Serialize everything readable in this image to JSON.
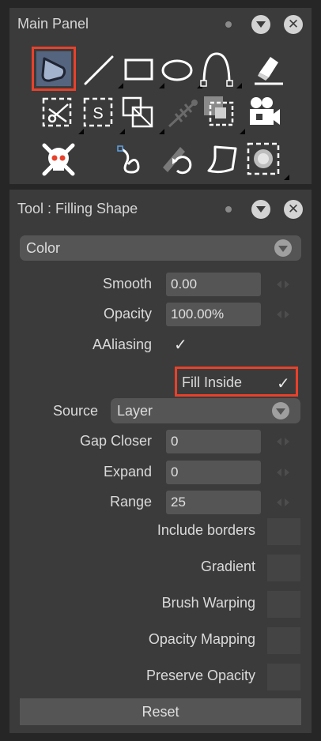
{
  "main_panel": {
    "title": "Main Panel",
    "tools": [
      {
        "icon": "geometric-fill-tool-icon",
        "selected": true
      },
      {
        "icon": "brush-line-tool-icon"
      },
      {
        "icon": "rectangle-tool-icon"
      },
      {
        "icon": "ellipse-tool-icon"
      },
      {
        "icon": "curve-tool-icon"
      },
      {
        "icon": "eraser-tool-icon"
      },
      {
        "icon": "cutter-tool-icon"
      },
      {
        "icon": "selection-tool-icon"
      },
      {
        "icon": "transform-tool-icon"
      },
      {
        "icon": "skeleton-tool-icon"
      },
      {
        "icon": "camera-frame-tool-icon"
      },
      {
        "icon": "camera-tool-icon"
      },
      {
        "icon": "skull-crossbones-tool-icon"
      },
      {
        "icon": "curl-path-tool-icon"
      },
      {
        "icon": "rotate-pencil-tool-icon"
      },
      {
        "icon": "paper-tool-icon"
      },
      {
        "icon": "blur-circle-tool-icon"
      }
    ]
  },
  "tool_panel": {
    "title": "Tool : Filling Shape",
    "mode_dropdown": "Color",
    "smooth": {
      "label": "Smooth",
      "value": "0.00"
    },
    "opacity": {
      "label": "Opacity",
      "value": "100.00%"
    },
    "aaliasing": {
      "label": "AAliasing",
      "checked": true,
      "mark": "✓"
    },
    "fill_inside": {
      "label": "Fill Inside",
      "checked": true,
      "mark": "✓"
    },
    "source": {
      "label": "Source",
      "value": "Layer"
    },
    "gap_closer": {
      "label": "Gap Closer",
      "value": "0"
    },
    "expand": {
      "label": "Expand",
      "value": "0"
    },
    "range": {
      "label": "Range",
      "value": "25"
    },
    "include_borders": {
      "label": "Include borders",
      "checked": false
    },
    "gradient": {
      "label": "Gradient",
      "checked": false
    },
    "brush_warping": {
      "label": "Brush Warping",
      "checked": false
    },
    "opacity_mapping": {
      "label": "Opacity Mapping",
      "checked": false
    },
    "preserve_opacity": {
      "label": "Preserve Opacity",
      "checked": false
    },
    "reset_label": "Reset"
  },
  "colors": {
    "selection_highlight": "#e8412b",
    "selected_tool_bg": "#55657f",
    "panel_bg": "#3b3b3b",
    "field_bg": "#555555"
  }
}
